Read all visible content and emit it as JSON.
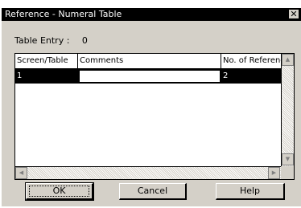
{
  "window": {
    "title": "Reference - Numeral Table",
    "close_glyph": "✕"
  },
  "table_entry": {
    "label": "Table Entry :",
    "value": "0"
  },
  "grid": {
    "columns": [
      "Screen/Table",
      "Comments",
      "No. of References"
    ],
    "rows": [
      {
        "screen_table": "1",
        "comments": "",
        "references": "2"
      }
    ],
    "scroll_icons": {
      "up": "▲",
      "down": "▼",
      "left": "◀",
      "right": "▶"
    }
  },
  "buttons": {
    "ok": "OK",
    "cancel": "Cancel",
    "help": "Help"
  }
}
